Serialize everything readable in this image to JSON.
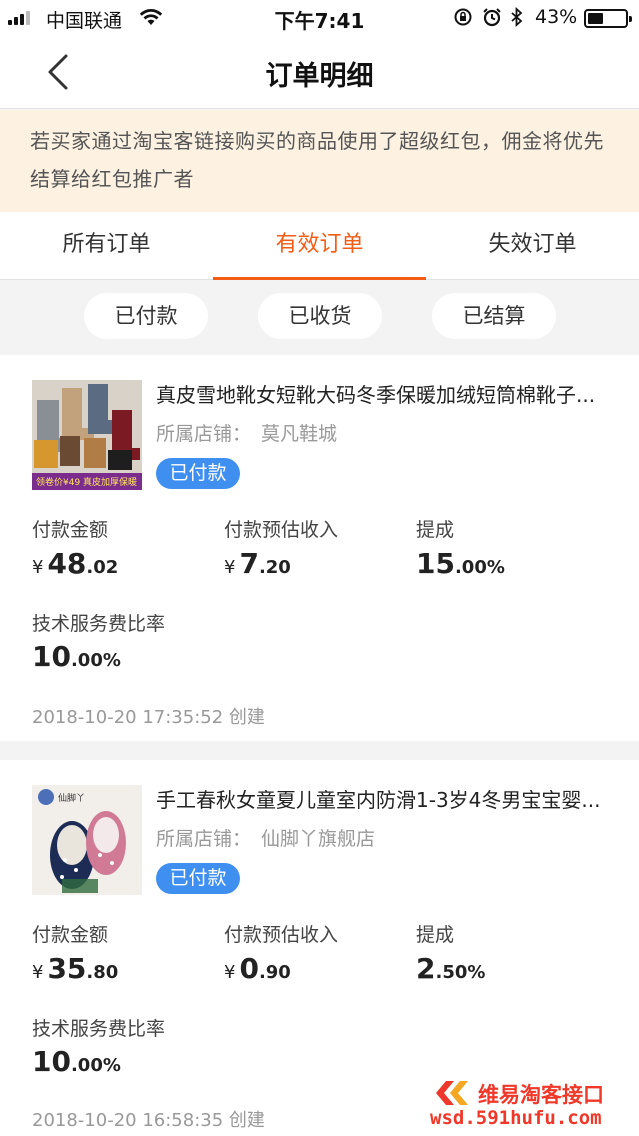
{
  "status_bar": {
    "carrier": "中国联通",
    "time": "下午7:41",
    "battery_percent": "43%",
    "battery_level": 0.43,
    "icons": [
      "signal-icon",
      "wifi-icon",
      "screen-rotation-lock-icon",
      "alarm-icon",
      "bluetooth-icon",
      "battery-icon"
    ]
  },
  "nav": {
    "title": "订单明细",
    "back_icon": "chevron-left-icon"
  },
  "notice": {
    "text": "若买家通过淘宝客链接购买的商品使用了超级红包，佣金将优先结算给红包推广者"
  },
  "tabs": [
    {
      "label": "所有订单",
      "active": false
    },
    {
      "label": "有效订单",
      "active": true
    },
    {
      "label": "失效订单",
      "active": false
    }
  ],
  "filters": [
    {
      "label": "已付款"
    },
    {
      "label": "已收货"
    },
    {
      "label": "已结算"
    }
  ],
  "metric_labels": {
    "payment": "付款金额",
    "estimated_income": "付款预估收入",
    "commission": "提成",
    "service_fee": "技术服务费比率"
  },
  "orders": [
    {
      "title": "真皮雪地靴女短靴大码冬季保暖加绒短筒棉靴子...",
      "shop_label": "所属店铺：",
      "shop_name": "莫凡鞋城",
      "status": "已付款",
      "image_caption": "领卷价¥49 真皮加厚保暖",
      "payment": {
        "currency": "¥",
        "integer": "48",
        "decimal": ".02"
      },
      "estimated_income": {
        "currency": "¥",
        "integer": "7",
        "decimal": ".20"
      },
      "commission": {
        "integer": "15",
        "decimal": ".00%"
      },
      "service_fee": {
        "integer": "10",
        "decimal": ".00%"
      },
      "created": "2018-10-20 17:35:52 创建"
    },
    {
      "title": "手工春秋女童夏儿童室内防滑1-3岁4冬男宝宝婴...",
      "shop_label": "所属店铺：",
      "shop_name": "仙脚丫旗舰店",
      "status": "已付款",
      "image_caption": "仙脚丫",
      "payment": {
        "currency": "¥",
        "integer": "35",
        "decimal": ".80"
      },
      "estimated_income": {
        "currency": "¥",
        "integer": "0",
        "decimal": ".90"
      },
      "commission": {
        "integer": "2",
        "decimal": ".50%"
      },
      "service_fee": {
        "integer": "10",
        "decimal": ".00%"
      },
      "created": "2018-10-20 16:58:35 创建"
    }
  ],
  "watermark": {
    "line1": "维易淘客接口",
    "line2": "wsd.591hufu.com"
  },
  "colors": {
    "accent": "#f25c15",
    "badge": "#3f8ff0",
    "notice_bg": "#fdf2e2",
    "watermark": "#f0382a"
  }
}
